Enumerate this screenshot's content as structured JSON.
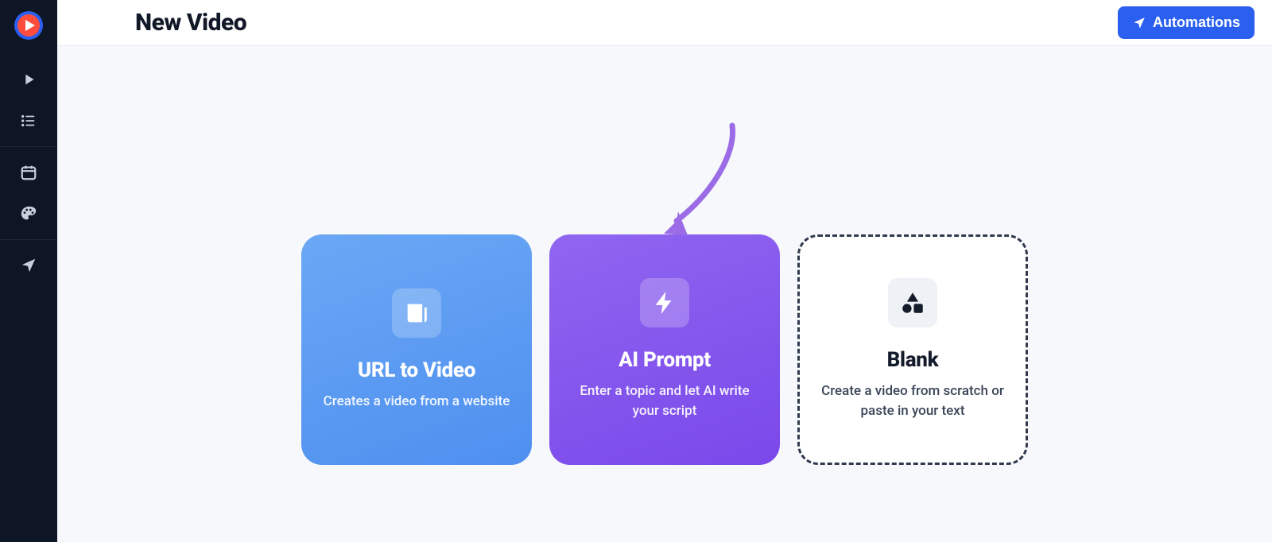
{
  "header": {
    "title": "New Video",
    "automations_label": "Automations"
  },
  "cards": {
    "url": {
      "title": "URL to Video",
      "desc": "Creates a video from a website"
    },
    "ai": {
      "title": "AI Prompt",
      "desc": "Enter a topic and let AI write your script"
    },
    "blank": {
      "title": "Blank",
      "desc": "Create a video from scratch or paste in your text"
    }
  },
  "colors": {
    "accent_blue": "#2a5ff0",
    "card_blue": "#5a98f2",
    "card_purple": "#8456ec",
    "dashed_border": "#2f3a4f",
    "arrow": "#9b6ce6"
  }
}
